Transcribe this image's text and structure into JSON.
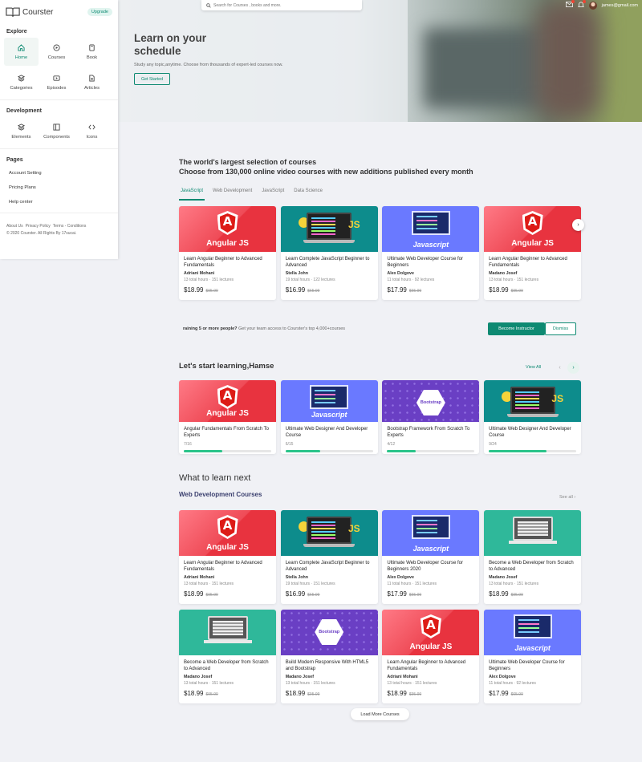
{
  "brand": {
    "name": "Courster",
    "upgrade": "Upgrade"
  },
  "sidebar": {
    "explore_title": "Explore",
    "explore": [
      {
        "label": "Home",
        "icon": "home-icon"
      },
      {
        "label": "Courses",
        "icon": "play-circle-icon"
      },
      {
        "label": "Book",
        "icon": "book-icon"
      },
      {
        "label": "Categories",
        "icon": "layers-icon"
      },
      {
        "label": "Episodes",
        "icon": "video-icon"
      },
      {
        "label": "Articles",
        "icon": "file-icon"
      }
    ],
    "development_title": "Development",
    "development": [
      {
        "label": "Elements",
        "icon": "layers-icon"
      },
      {
        "label": "Components",
        "icon": "layout-icon"
      },
      {
        "label": "Icons",
        "icon": "code-icon"
      }
    ],
    "pages_title": "Pages",
    "pages": [
      "Account Setting",
      "Pricing Plans",
      "Help center"
    ],
    "footer_links": [
      "About Us",
      "Privacy Policy",
      "Terms - Conditions"
    ],
    "copyright": "© 2020 Courster. All Rights By 17sucai."
  },
  "search": {
    "placeholder": "Search for Courses , books and more."
  },
  "topbar": {
    "user_email": "james@gmail.com"
  },
  "hero": {
    "title": "Learn on your schedule",
    "subtitle": "Study any topic,anytime. Choose from thousands of expert-led courses now.",
    "cta": "Get Started"
  },
  "selection": {
    "title1": "The world's largest selection of courses",
    "title2": "Choose from 130,000 online video courses with new additions published every month",
    "tabs": [
      "JavaScript",
      "Web Development",
      "JavaScript",
      "Data Science"
    ],
    "cards": [
      {
        "thumb": "angular",
        "title": "Learn Angular Beginner to Advanced Fundamentals",
        "author": "Adriani Mohani",
        "meta": "13 total hours  ·  151 lectures",
        "price": "$18.99",
        "old_price": "$95.99"
      },
      {
        "thumb": "js",
        "title": "Learn Complete JavaScript Beginner to Advanced",
        "author": "Stella John",
        "meta": "19 total hours  ·  122 lectures",
        "price": "$16.99",
        "old_price": "$65.99"
      },
      {
        "thumb": "web",
        "title": "Ultimate Web Developer Course for Beginners",
        "author": "Alex Dolgove",
        "meta": "11 total hours  ·  92 lectures",
        "price": "$17.99",
        "old_price": "$65.99"
      },
      {
        "thumb": "angular",
        "title": "Learn Angular Beginner to Advanced Fundamentals",
        "author": "Madano Josef",
        "meta": "13 total hours  ·  151 lectures",
        "price": "$18.99",
        "old_price": "$95.99"
      }
    ]
  },
  "training": {
    "bold": "raining 5 or more people?",
    "text": " Get your team access to Courster's top 4,000+courses",
    "instructor_btn": "Become Instructor",
    "dismiss_btn": "Dismiss"
  },
  "learning": {
    "title": "Let's start learning,Hamse",
    "view_all": "View All",
    "cards": [
      {
        "thumb": "angular",
        "title": "Angular Fundamentals From Scratch To Experts",
        "progress_text": "7/16",
        "progress": 0.44
      },
      {
        "thumb": "web",
        "title": "Ultimate Web Designer And Developer Course",
        "progress_text": "6/15",
        "progress": 0.4
      },
      {
        "thumb": "bootstrap",
        "title": "Bootstrap Framework From Scratch To Experts",
        "progress_text": "4/12",
        "progress": 0.33
      },
      {
        "thumb": "js",
        "title": "Ultimate Web Designer And Developer Course",
        "progress_text": "9/24",
        "progress": 0.66
      }
    ]
  },
  "next": {
    "title": "What to learn next",
    "subtitle": "Web Development Courses",
    "see_all": "See all",
    "cards": [
      {
        "thumb": "angular",
        "title": "Learn Angular Beginner to Advanced Fundamentals",
        "author": "Adriani Mohani",
        "meta": "13 total hours  ·  151 lectures",
        "price": "$18.99",
        "old_price": "$95.99"
      },
      {
        "thumb": "js",
        "title": "Learn Complete JavaScript Beginner to Advanced",
        "author": "Stella John",
        "meta": "19 total hours  ·  151 lectures",
        "price": "$16.99",
        "old_price": "$65.99"
      },
      {
        "thumb": "web",
        "title": "Ultimate Web Developer Course for Beginners 2020",
        "author": "Alex Dolgove",
        "meta": "11 total hours  ·  151 lectures",
        "price": "$17.99",
        "old_price": "$65.99"
      },
      {
        "thumb": "green",
        "title": "Become a Web Developer from Scratch to Advanced",
        "author": "Madano Josef",
        "meta": "13 total hours  ·  151 lectures",
        "price": "$18.99",
        "old_price": "$95.99"
      },
      {
        "thumb": "green",
        "title": "Become a Web Developer from Scratch to Advanced",
        "author": "Madano Josef",
        "meta": "13 total hours  ·  151 lectures",
        "price": "$18.99",
        "old_price": "$95.99"
      },
      {
        "thumb": "bootstrap",
        "title": "Build Modern Responsive With HTML5 and Bootstrap",
        "author": "Madano Josef",
        "meta": "13 total hours  ·  151 lectures",
        "price": "$18.99",
        "old_price": "$95.99"
      },
      {
        "thumb": "angular",
        "title": "Learn Angular Beginner to Advanced Fundamentals",
        "author": "Adriani Mohani",
        "meta": "13 total hours  ·  151 lectures",
        "price": "$18.99",
        "old_price": "$95.99"
      },
      {
        "thumb": "web",
        "title": "Ultimate Web Developer Course for Beginners",
        "author": "Alex Dolgove",
        "meta": "11 total hours  ·  92 lectures",
        "price": "$17.99",
        "old_price": "$65.99"
      }
    ],
    "load_more": "Load More Courses"
  },
  "thumb_text": {
    "angular": "Angular JS",
    "js": "JS",
    "web": "Javascript",
    "bootstrap": "Bootstrap"
  },
  "colors": {
    "accent": "#0e8a72",
    "progress": "#2bc48a"
  }
}
